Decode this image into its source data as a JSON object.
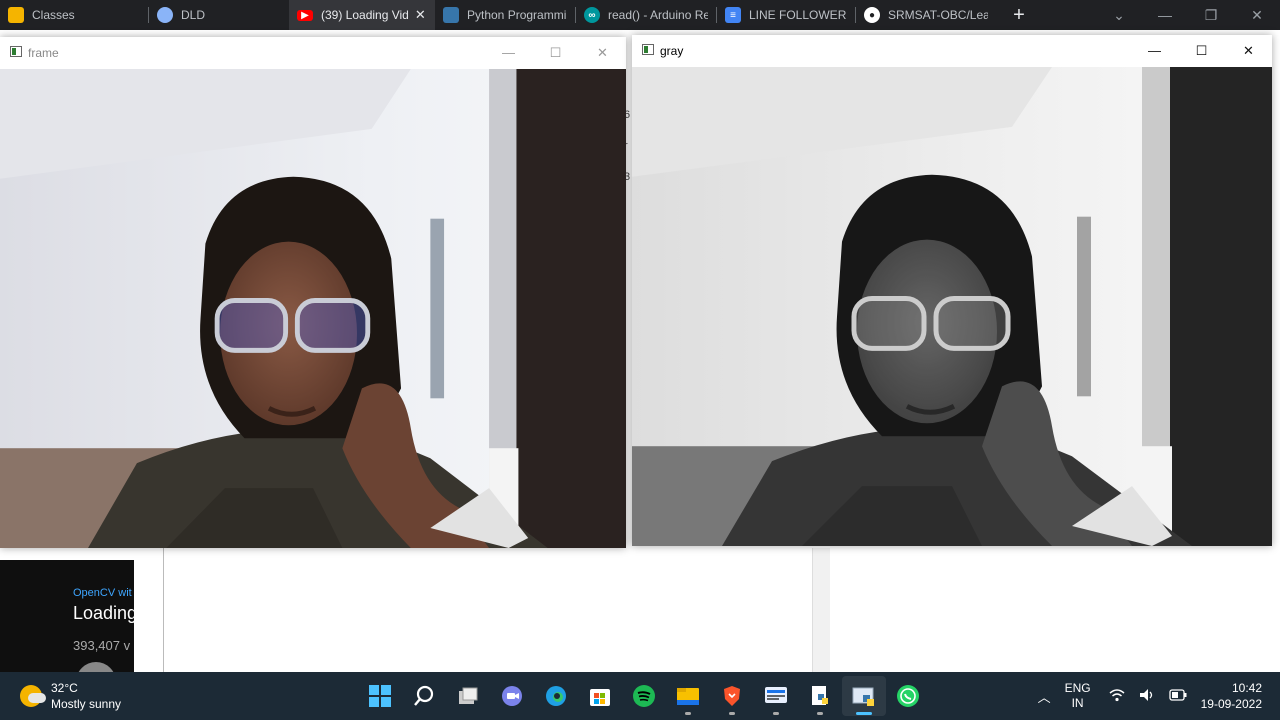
{
  "browser": {
    "tabs": [
      {
        "title": "Classes",
        "icon": "google-classroom-icon",
        "color": "#f5b400",
        "active": false
      },
      {
        "title": "DLD",
        "icon": "site-icon",
        "color": "#8ab4f8",
        "active": false
      },
      {
        "title": "(39) Loading Vid",
        "icon": "youtube-icon",
        "color": "#ff0000",
        "active": true
      },
      {
        "title": "Python Programmin",
        "icon": "python-icon",
        "color": "#3776ab",
        "active": false
      },
      {
        "title": "read() - Arduino Refe",
        "icon": "arduino-icon",
        "color": "#00979d",
        "active": false
      },
      {
        "title": "LINE FOLLOWER CO",
        "icon": "google-docs-icon",
        "color": "#4285f4",
        "active": false
      },
      {
        "title": "SRMSAT-OBC/Learn",
        "icon": "github-icon",
        "color": "#ffffff",
        "active": false
      }
    ],
    "new_tab": "+"
  },
  "youtube": {
    "channel": "OpenCV wit",
    "title": "Loading",
    "views": "393,407 v"
  },
  "background_chars": [
    "6",
    "r",
    "3"
  ],
  "windows": {
    "frame": {
      "title": "frame"
    },
    "gray": {
      "title": "gray"
    }
  },
  "taskbar": {
    "weather_temp": "32°C",
    "weather_desc": "Mostly sunny",
    "apps": [
      "windows-start-icon",
      "search-icon",
      "task-view-icon",
      "teams-chat-icon",
      "edge-icon",
      "microsoft-store-icon",
      "spotify-icon",
      "file-explorer-icon",
      "brave-icon",
      "app-icon",
      "python-file-icon",
      "python-window-icon",
      "whatsapp-icon"
    ],
    "lang_top": "ENG",
    "lang_bottom": "IN",
    "time": "10:42",
    "date": "19-09-2022"
  },
  "colors": {
    "taskbar": "#1c2a36",
    "tabstrip": "#202124",
    "accent": "#4cc2ff"
  }
}
